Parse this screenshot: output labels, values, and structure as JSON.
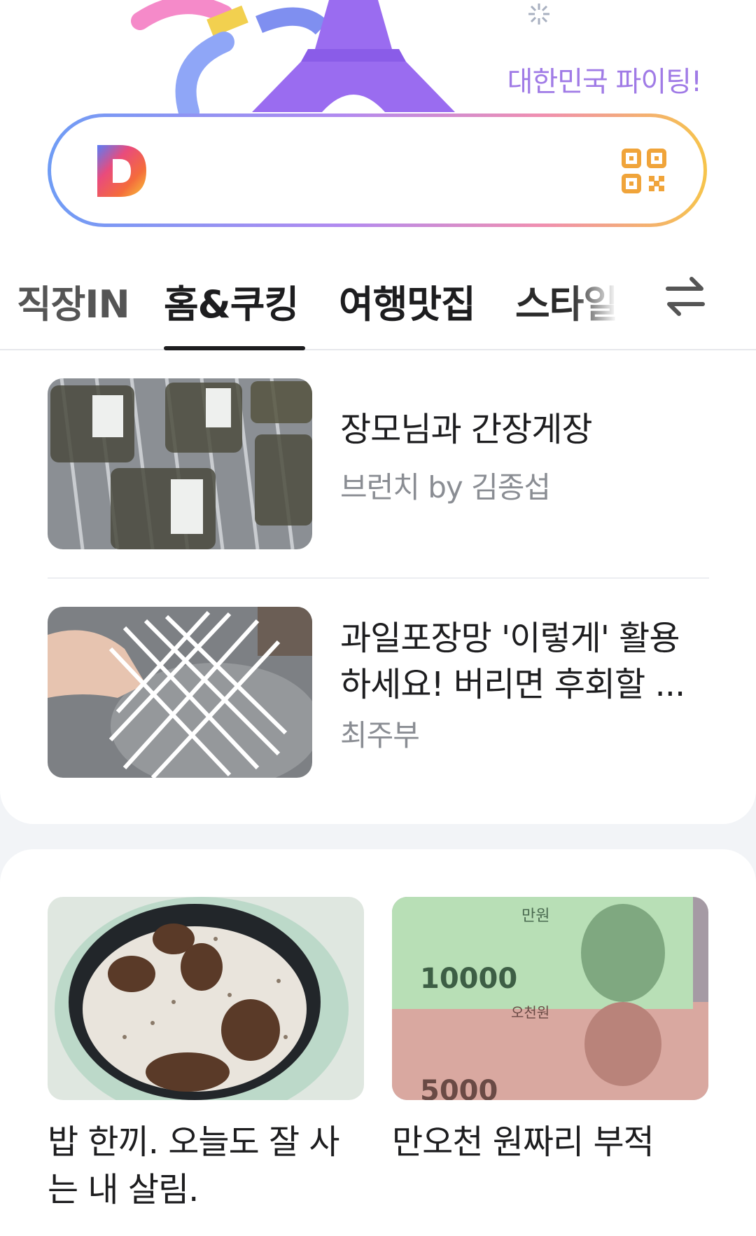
{
  "banner": {
    "text": "대한민국 파이팅!"
  },
  "search": {
    "logo_icon": "daum-d-logo",
    "qr_icon": "qr-code-icon"
  },
  "tabs": {
    "items": [
      {
        "label": "직장IN",
        "active": false
      },
      {
        "label": "홈&쿠킹",
        "active": true
      },
      {
        "label": "여행맛집",
        "active": false
      },
      {
        "label": "스타일",
        "active": false
      }
    ],
    "edit_icon": "swap-arrows-icon"
  },
  "feed": {
    "items": [
      {
        "title": "장모님과 간장게장",
        "source": "브런치 by 김종섭"
      },
      {
        "title_line1": "과일포장망 '이렇게' 활용",
        "title_line2": "하세요! 버리면 후회할 ...",
        "source": "최주부"
      }
    ]
  },
  "grid": {
    "items": [
      {
        "title_line1": "밥 한끼. 오늘도 잘 사",
        "title_line2": "는 내 살림."
      },
      {
        "title_line1": "만오천 원짜리 부적",
        "bill_large": "10000",
        "bill_small": "만원",
        "bill_small2": "오천원",
        "bill_large2": "5000"
      }
    ]
  }
}
